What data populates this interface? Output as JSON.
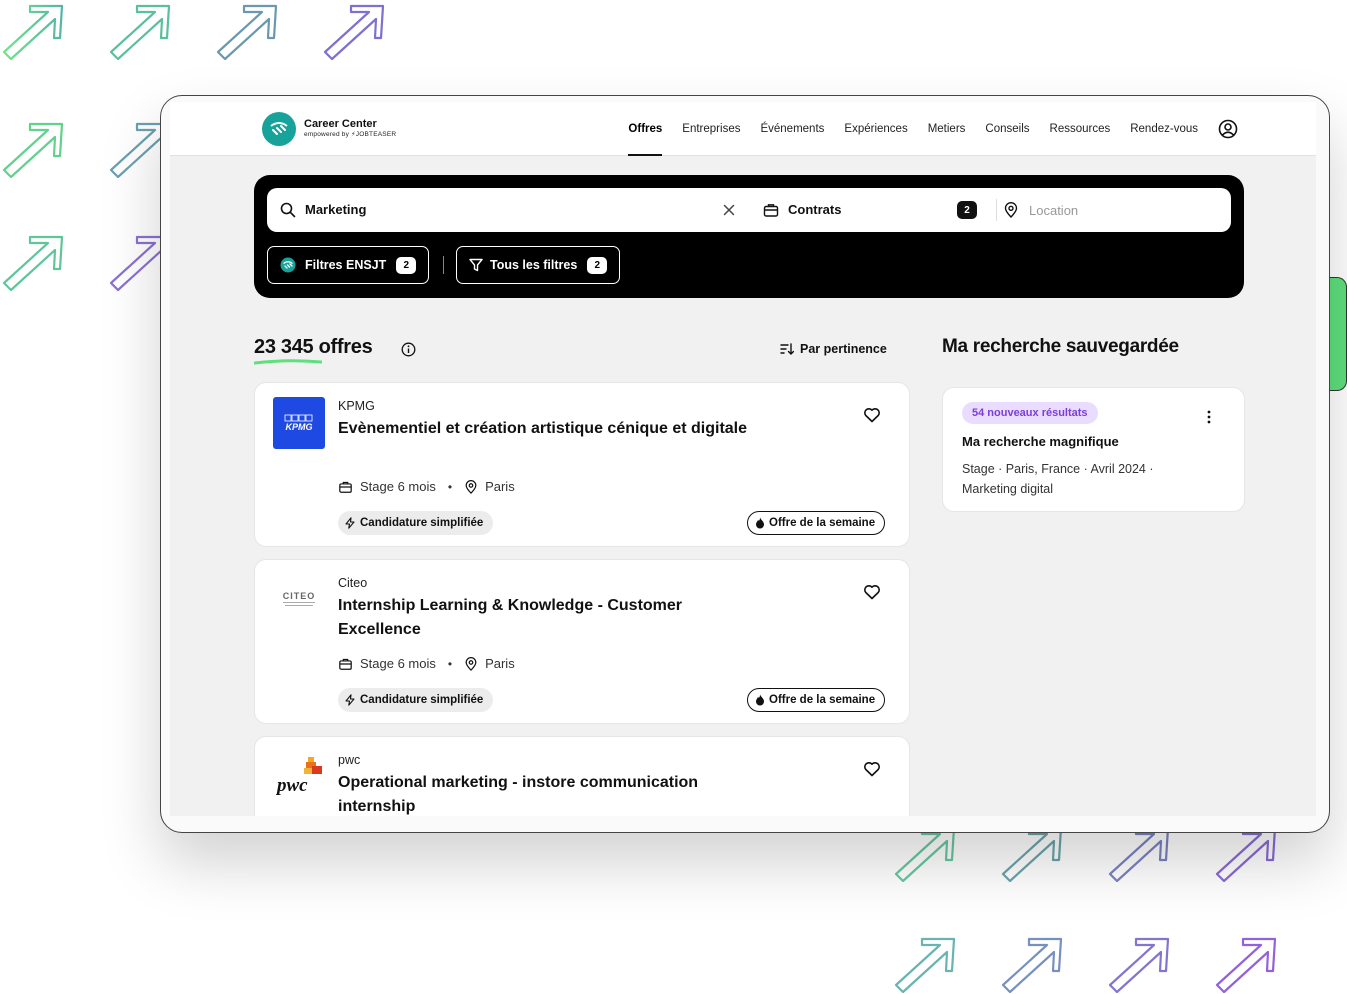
{
  "brand": {
    "title": "Career Center",
    "subtitle": "empowered by ⚡JOBTEASER"
  },
  "nav": {
    "items": [
      {
        "label": "Offres",
        "active": true
      },
      {
        "label": "Entreprises",
        "active": false
      },
      {
        "label": "Événements",
        "active": false
      },
      {
        "label": "Expériences",
        "active": false
      },
      {
        "label": "Metiers",
        "active": false
      },
      {
        "label": "Conseils",
        "active": false
      },
      {
        "label": "Ressources",
        "active": false
      },
      {
        "label": "Rendez-vous",
        "active": false
      }
    ],
    "account_icon": "user-circle-icon"
  },
  "search": {
    "query": "Marketing",
    "contracts_label": "Contrats",
    "contracts_count": "2",
    "location_placeholder": "Location",
    "location_value": ""
  },
  "filters": {
    "school_label": "Filtres ENSJT",
    "school_count": "2",
    "all_label": "Tous les filtres",
    "all_count": "2"
  },
  "results": {
    "count_label": "23 345 offres",
    "sort_label": "Par pertinence"
  },
  "jobs": [
    {
      "company": "KPMG",
      "logo_text": "KPMG",
      "title": "Evènementiel et création artistique cénique et digitale",
      "contract": "Stage 6 mois",
      "location": "Paris",
      "badge_simplified": "Candidature simplifiée",
      "badge_week": "Offre de la semaine"
    },
    {
      "company": "Citeo",
      "logo_text": "CITEO",
      "title": "Internship Learning & Knowledge - Customer Excellence",
      "contract": "Stage 6 mois",
      "location": "Paris",
      "badge_simplified": "Candidature simplifiée",
      "badge_week": "Offre de la semaine"
    },
    {
      "company": "pwc",
      "logo_text": "pwc",
      "title": "Operational marketing - instore communication internship",
      "contract": "",
      "location": "",
      "badge_simplified": "",
      "badge_week": ""
    }
  ],
  "saved": {
    "title": "Ma recherche sauvegardée",
    "new_results": "54 nouveaux résultats",
    "name": "Ma recherche magnifique",
    "details": "Stage · Paris, France · Avril 2024 · Marketing digital"
  },
  "colors": {
    "accent_green": "#5ee07c",
    "brand_teal": "#17a39a",
    "kpmg_blue": "#1e49e2",
    "purple_badge": "#7d3ed6"
  }
}
